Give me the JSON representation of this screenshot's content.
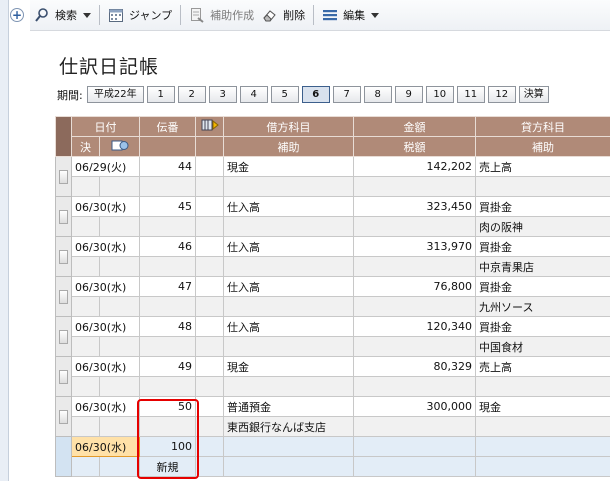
{
  "toolbar": {
    "search_label": "検索",
    "jump_label": "ジャンプ",
    "aux_create_label": "補助作成",
    "delete_label": "削除",
    "edit_label": "編集"
  },
  "page_title": "仕訳日記帳",
  "periods": {
    "label": "期間:",
    "year_button": "平成22年",
    "months": [
      "1",
      "2",
      "3",
      "4",
      "5",
      "6",
      "7",
      "8",
      "9",
      "10",
      "11",
      "12"
    ],
    "active_month": "6",
    "settlement_button": "決算"
  },
  "grid": {
    "header1": {
      "date": "日付",
      "slip": "伝番",
      "debit": "借方科目",
      "amount": "金額",
      "credit": "貸方科目"
    },
    "header2": {
      "settle": "決",
      "debit_sub": "補助",
      "tax": "税額",
      "credit_sub": "補助"
    },
    "rows": [
      {
        "date": "06/29(火)",
        "slip": "44",
        "debit": "現金",
        "amount": "142,202",
        "credit": "売上高",
        "debit_sub": "",
        "credit_sub": ""
      },
      {
        "date": "06/30(水)",
        "slip": "45",
        "debit": "仕入高",
        "amount": "323,450",
        "credit": "買掛金",
        "debit_sub": "",
        "credit_sub": "肉の阪神"
      },
      {
        "date": "06/30(水)",
        "slip": "46",
        "debit": "仕入高",
        "amount": "313,970",
        "credit": "買掛金",
        "debit_sub": "",
        "credit_sub": "中京青果店"
      },
      {
        "date": "06/30(水)",
        "slip": "47",
        "debit": "仕入高",
        "amount": "76,800",
        "credit": "買掛金",
        "debit_sub": "",
        "credit_sub": "九州ソース"
      },
      {
        "date": "06/30(水)",
        "slip": "48",
        "debit": "仕入高",
        "amount": "120,340",
        "credit": "買掛金",
        "debit_sub": "",
        "credit_sub": "中国食材"
      },
      {
        "date": "06/30(水)",
        "slip": "49",
        "debit": "現金",
        "amount": "80,329",
        "credit": "売上高",
        "debit_sub": "",
        "credit_sub": ""
      },
      {
        "date": "06/30(水)",
        "slip": "50",
        "debit": "普通預金",
        "amount": "300,000",
        "credit": "現金",
        "debit_sub": "東西銀行なんば支店",
        "credit_sub": ""
      }
    ],
    "new_row": {
      "date": "06/30(水)",
      "slip": "100",
      "status": "新規"
    }
  },
  "colors": {
    "header_bg": "#b08a78",
    "highlight_box": "#e60000",
    "edit_cell": "#ffe1a8"
  },
  "icons": [
    "plus-icon",
    "search-icon",
    "calendar-icon",
    "aux-create-icon",
    "eraser-icon",
    "edit-menu-icon",
    "memo-icon",
    "column-picker-icon"
  ]
}
